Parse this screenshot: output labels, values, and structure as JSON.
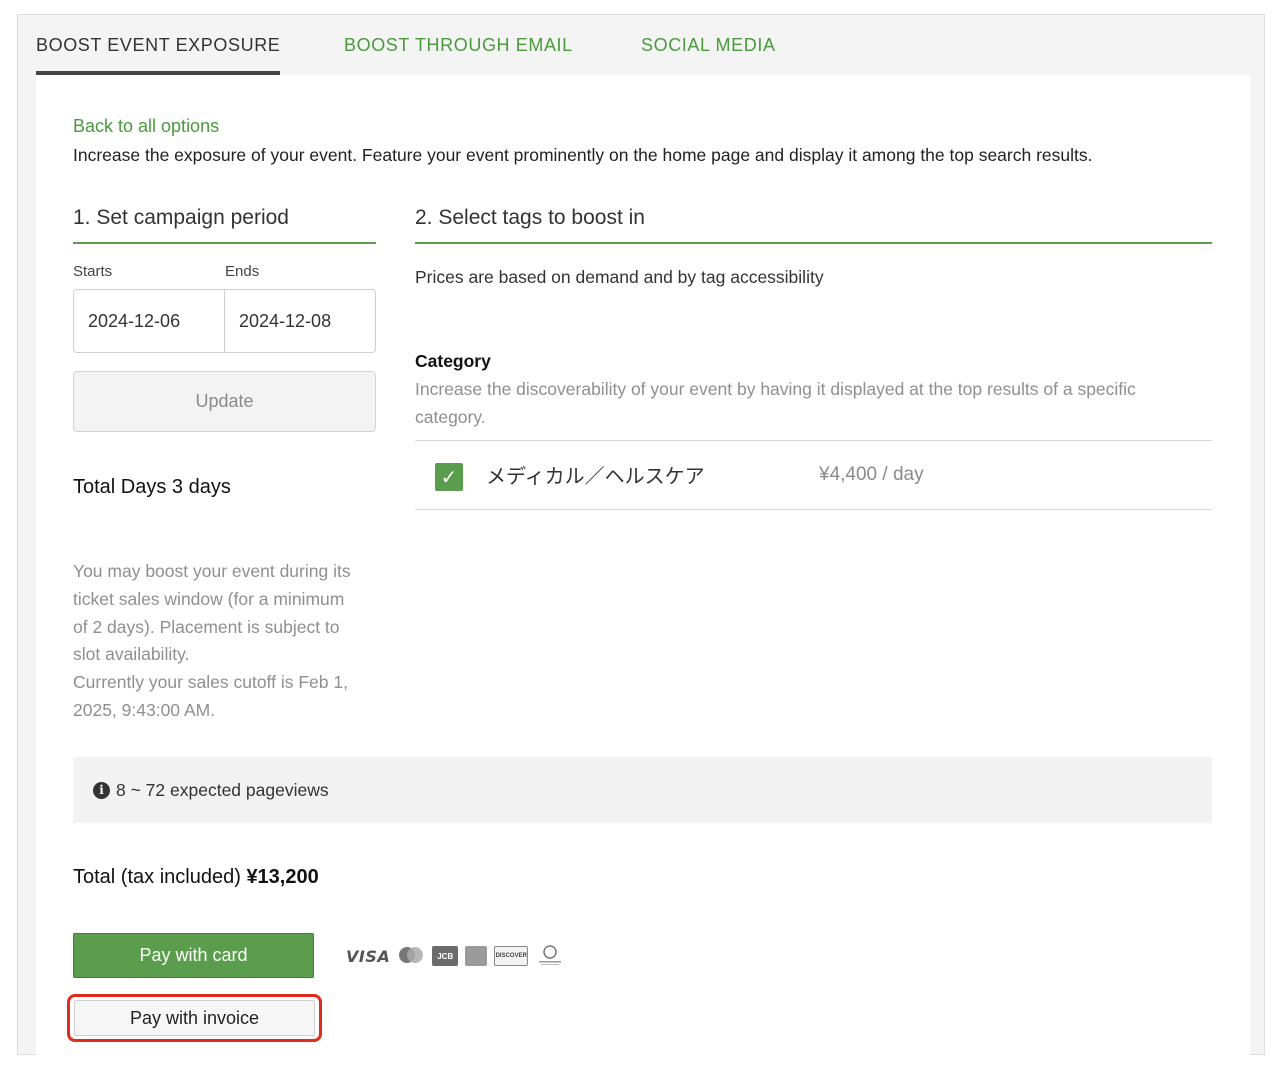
{
  "tabs": [
    {
      "label": "BOOST EVENT EXPOSURE",
      "active": true
    },
    {
      "label": "BOOST THROUGH EMAIL",
      "active": false
    },
    {
      "label": "SOCIAL MEDIA",
      "active": false
    }
  ],
  "back_link": "Back to all options",
  "intro": "Increase the exposure of your event. Feature your event prominently on the home page and display it among the top search results.",
  "campaign": {
    "title": "1. Set campaign period",
    "starts_label": "Starts",
    "ends_label": "Ends",
    "start_date": "2024-12-06",
    "end_date": "2024-12-08",
    "update_label": "Update",
    "total_days": "Total Days 3 days",
    "note_lines": [
      "You may boost your event during its",
      "ticket sales window (for a minimum",
      "of 2 days). Placement is subject to",
      "slot availability.",
      "Currently your sales cutoff is Feb 1,",
      "2025, 9:43:00 AM."
    ]
  },
  "tags": {
    "title": "2. Select tags to boost in",
    "prices_note": "Prices are based on demand and by tag accessibility",
    "category_title": "Category",
    "category_desc": "Increase the discoverability of your event by having it displayed at the top results of a specific category.",
    "items": [
      {
        "name": "メディカル／ヘルスケア",
        "price": "¥4,400 / day",
        "checked": true
      }
    ]
  },
  "pageviews": "8 ~ 72 expected pageviews",
  "total": {
    "label": "Total (tax included)",
    "amount": "¥13,200"
  },
  "payment": {
    "card_label": "Pay with card",
    "invoice_label": "Pay with invoice",
    "card_logos": [
      "VISA",
      "JCB",
      "DISCOVER"
    ]
  },
  "colors": {
    "accent": "#5a9d4c",
    "highlight": "#e02b20"
  }
}
